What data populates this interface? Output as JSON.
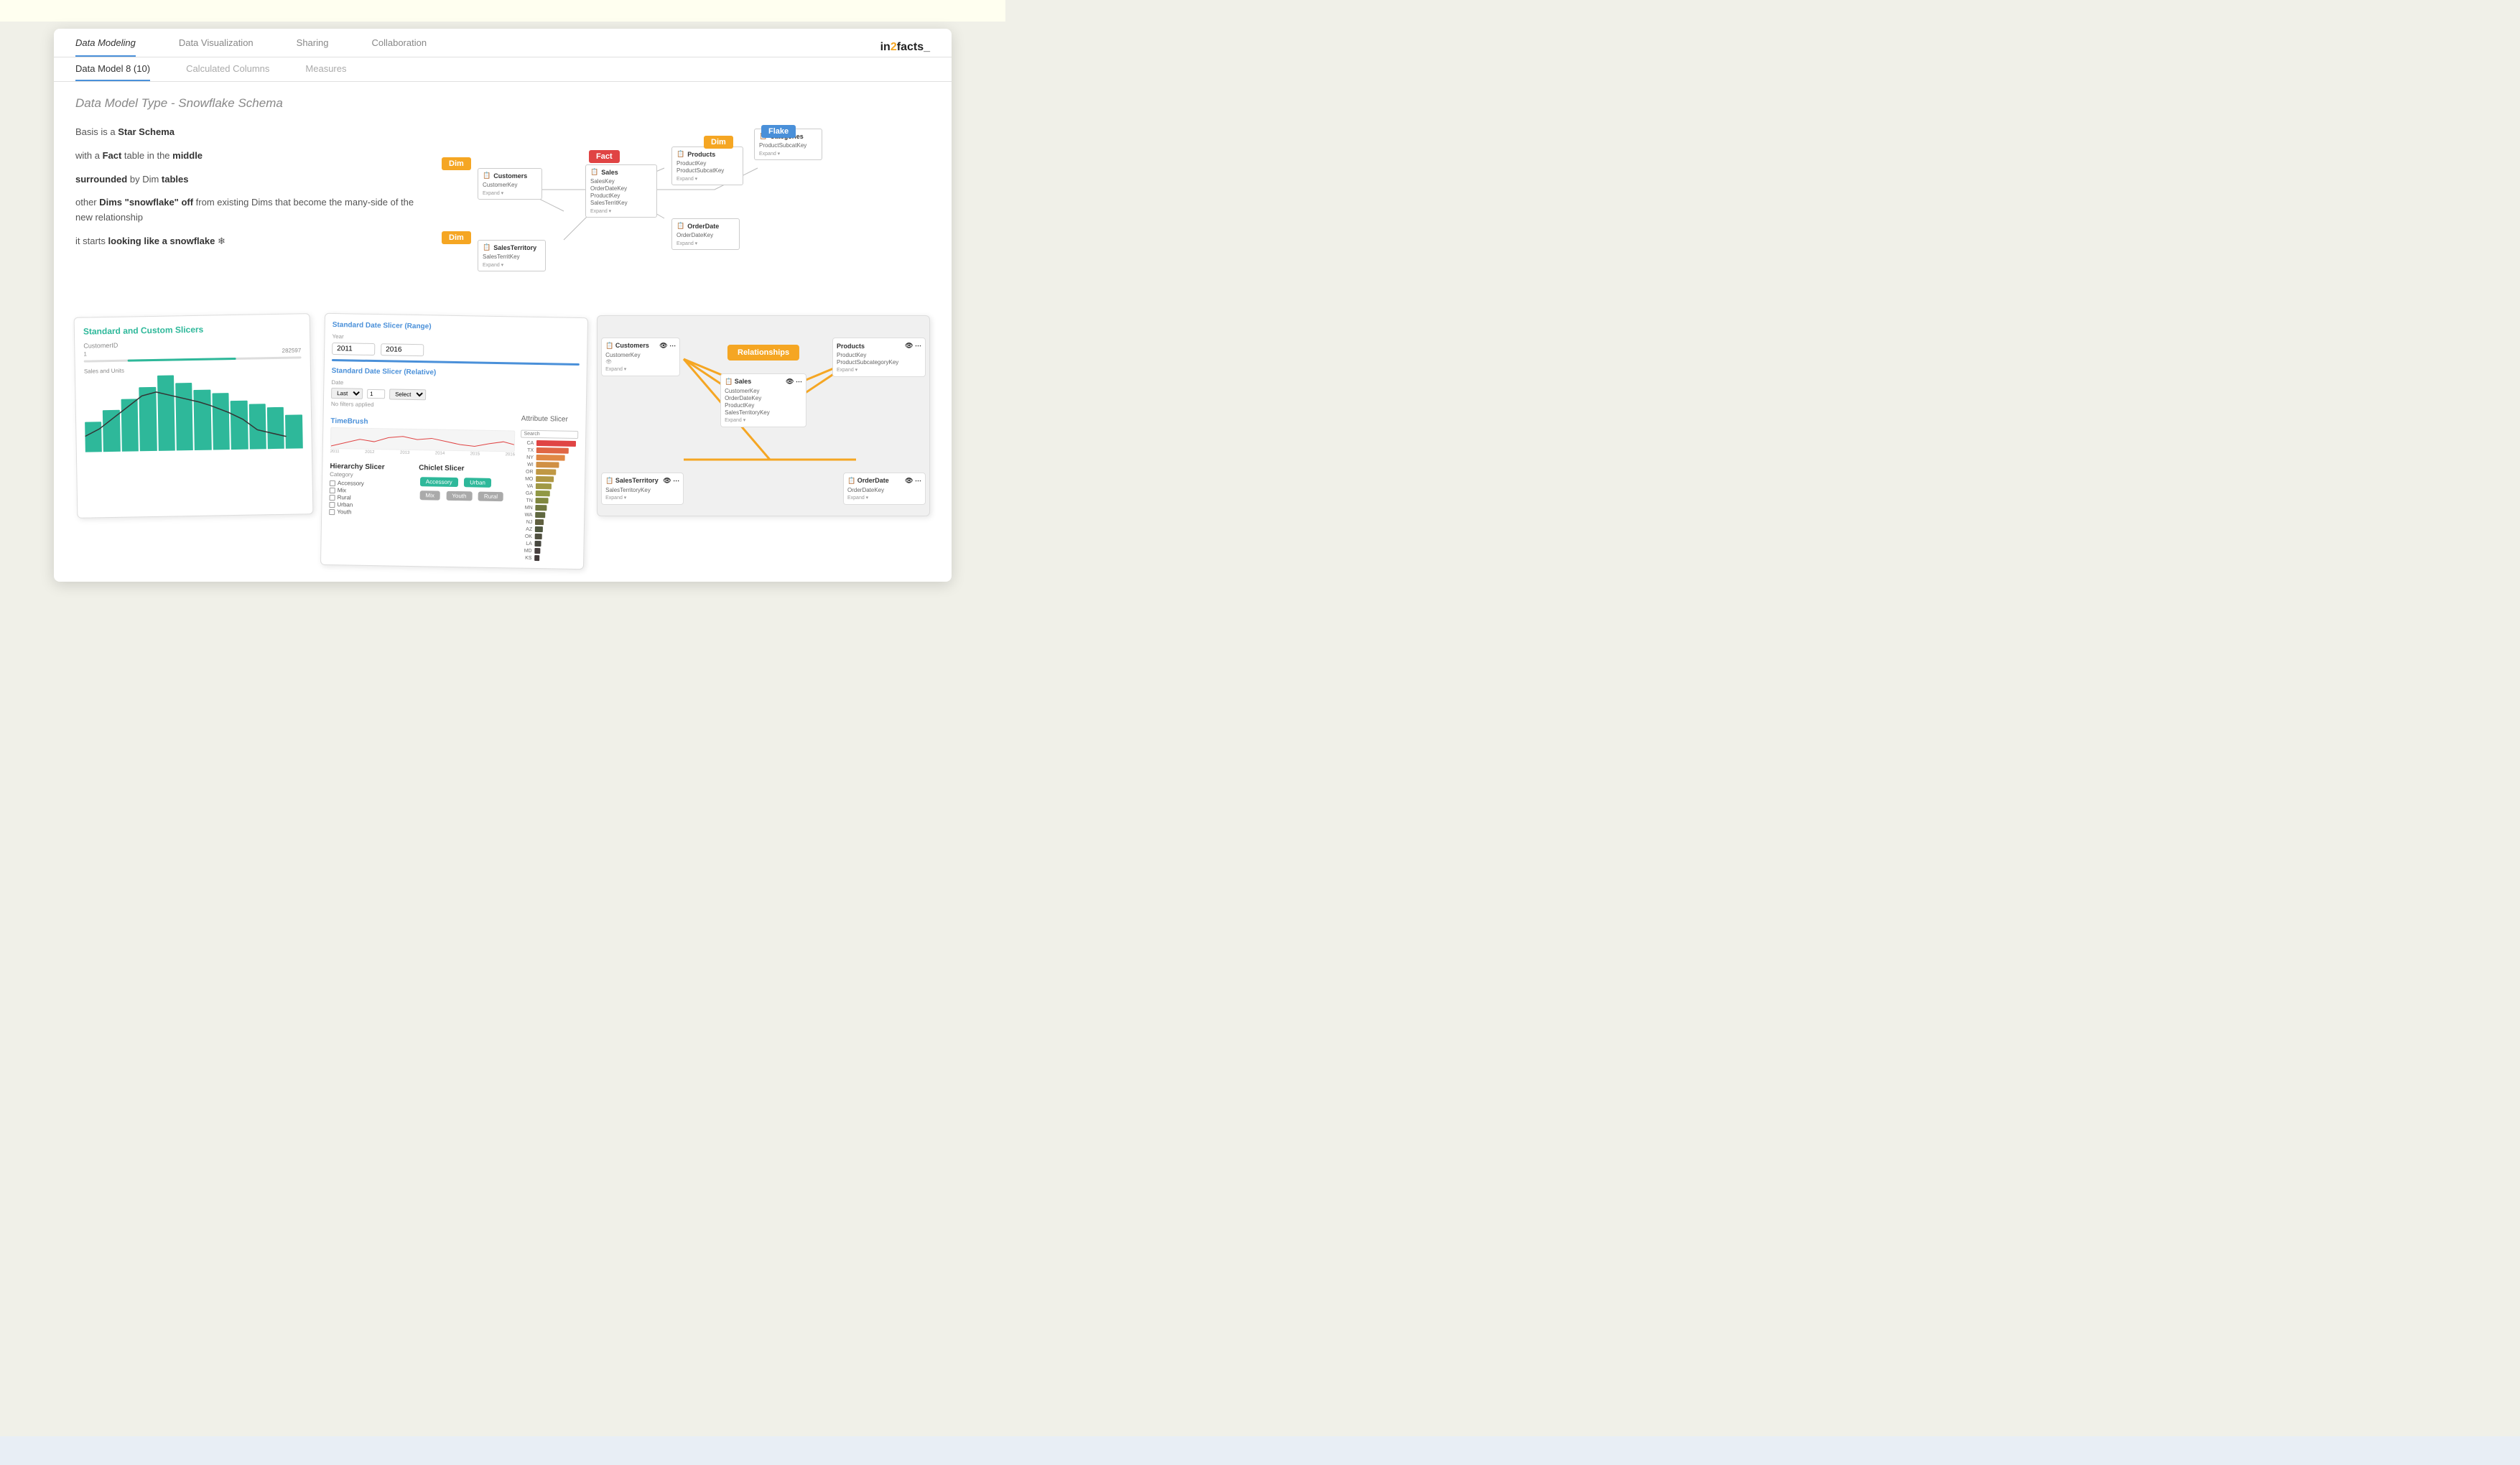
{
  "app": {
    "logo": "in2facts_",
    "logo_accent": "2"
  },
  "nav": {
    "top_links": [
      {
        "label": "Data Modeling",
        "active": true
      },
      {
        "label": "Data Visualization",
        "active": false
      },
      {
        "label": "Sharing",
        "active": false
      },
      {
        "label": "Collaboration",
        "active": false
      }
    ],
    "sub_links": [
      {
        "label": "Data Model 8 (10)",
        "active": true
      },
      {
        "label": "Calculated Columns",
        "active": false
      },
      {
        "label": "Measures",
        "active": false
      }
    ]
  },
  "schema": {
    "title": "Data Model Type - Snowflake Schema",
    "text1": "Basis is a Star Schema",
    "text2": "with a Fact table in the middle",
    "text3": "surrounded by Dim tables",
    "text4": "other Dims \"snowflake\" off from existing Dims that become the many-side of the new relationship",
    "text5": "it starts looking like a snowflake ❄"
  },
  "slicers": {
    "title": "Standard and Custom Slicers",
    "customer_label": "CustomerID",
    "customer_range": "1   282597",
    "sales_units_label": "Sales and Units",
    "date_slicer_range_title": "Standard Date Slicer (Range)",
    "date_year_label": "Year",
    "date_from": "2011",
    "date_to": "2016",
    "date_relative_title": "Standard Date Slicer (Relative)",
    "date_filter_label": "Date",
    "last_label": "Last",
    "select_label": "Select",
    "no_filters": "No filters applied",
    "timebrush_title": "TimeBrush",
    "hierarchy_title": "Hierarchy Slicer",
    "hierarchy_category": "Category",
    "hierarchy_items": [
      "Accessory",
      "Mix",
      "Rural",
      "Urban",
      "Youth"
    ],
    "chiclet_title": "Chiclet Slicer",
    "chiclet_items": [
      "Accessory",
      "Urban",
      "Mix",
      "Youth",
      "Rural"
    ],
    "attr_title": "Attribute Slicer",
    "attr_search": "Search"
  },
  "relationships": {
    "tables": [
      {
        "name": "Customers",
        "fields": [
          "CustomerKey"
        ],
        "expand": "Expand"
      },
      {
        "name": "Products",
        "fields": [
          "ProductKey",
          "ProductSubcategoryKey"
        ],
        "expand": "Expand"
      },
      {
        "name": "Sales",
        "fields": [
          "CustomerKey",
          "OrderDateKey",
          "ProductKey",
          "SalesTerritoryKey"
        ],
        "expand": "Expand"
      },
      {
        "name": "SalesTerritory",
        "fields": [
          "SalesTerritoryKey"
        ],
        "expand": "Expand"
      },
      {
        "name": "OrderDate",
        "fields": [
          "OrderDateKey"
        ],
        "expand": "Expand"
      }
    ],
    "badge": "Relationships"
  },
  "colors": {
    "teal": "#2eb89a",
    "orange": "#f5a623",
    "blue": "#4a90d9",
    "red": "#e04444",
    "dark": "#333333",
    "light_gray": "#f5f5f5"
  }
}
